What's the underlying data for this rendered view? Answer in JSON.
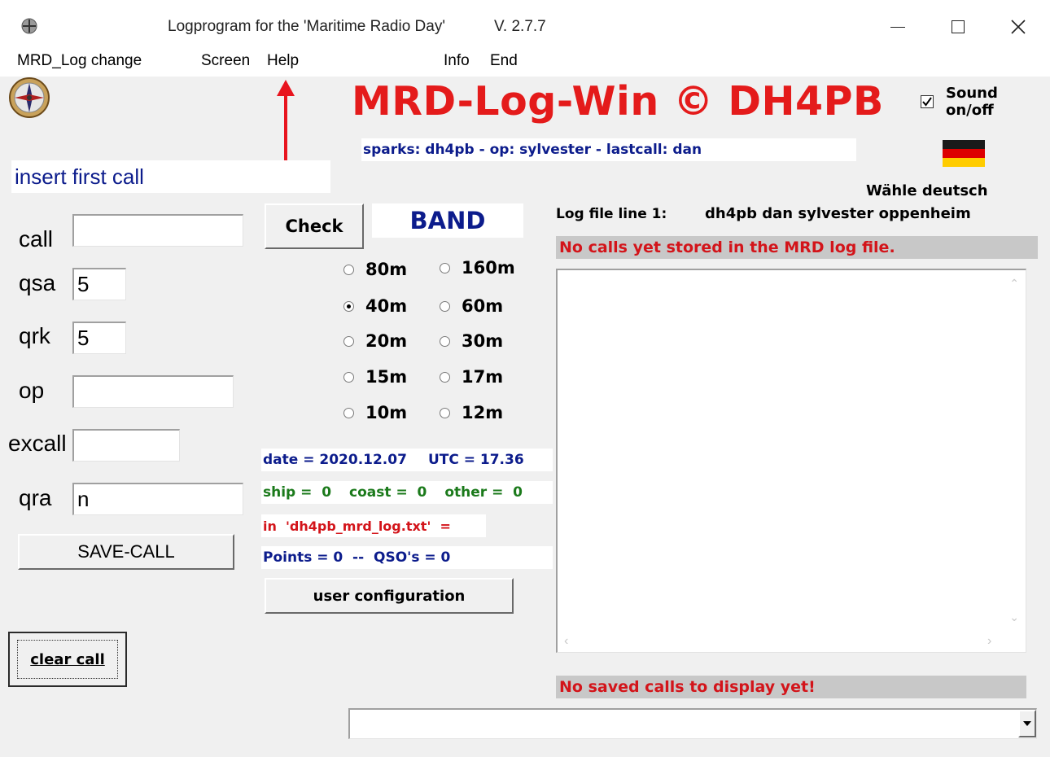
{
  "titlebar": {
    "title": "Logprogram for the 'Maritime Radio Day'",
    "version": "V. 2.7.7",
    "minimize": "—",
    "maximize": "☐",
    "close": "✕"
  },
  "menu": {
    "mrd_log_change": "MRD_Log change",
    "screen": "Screen",
    "help": "Help",
    "info": "Info",
    "end": "End"
  },
  "header": {
    "logo_title": "MRD-Log-Win © DH4PB",
    "sound_label_line1": "Sound",
    "sound_label_line2": "on/off",
    "sound_checked": true,
    "status_line": "sparks: dh4pb - op: sylvester - lastcall: dan",
    "language_label": "Wähle deutsch"
  },
  "left": {
    "prompt": "insert first call",
    "fields": {
      "call": {
        "label": "call",
        "value": ""
      },
      "qsa": {
        "label": "qsa",
        "value": "5"
      },
      "qrk": {
        "label": "qrk",
        "value": "5"
      },
      "op": {
        "label": "op",
        "value": ""
      },
      "excall": {
        "label": "excall",
        "value": ""
      },
      "qra": {
        "label": "qra",
        "value": "n"
      }
    },
    "save_button": "SAVE-CALL",
    "clear_button": "clear call"
  },
  "middle": {
    "check_button": "Check",
    "band_title": "BAND",
    "bands": [
      {
        "label": "80m",
        "selected": false
      },
      {
        "label": "160m",
        "selected": false
      },
      {
        "label": "40m",
        "selected": true
      },
      {
        "label": "60m",
        "selected": false
      },
      {
        "label": "20m",
        "selected": false
      },
      {
        "label": "30m",
        "selected": false
      },
      {
        "label": "15m",
        "selected": false
      },
      {
        "label": "17m",
        "selected": false
      },
      {
        "label": "10m",
        "selected": false
      },
      {
        "label": "12m",
        "selected": false
      }
    ],
    "date_line": "date = 2020.12.07",
    "utc_line": "UTC = 17.36",
    "ship": "ship =  0",
    "coast": "coast =  0",
    "other": "other =  0",
    "file_line": "in  'dh4pb_mrd_log.txt'  =",
    "points_line": "Points = 0  --  QSO's = 0",
    "user_config_button": "user configuration"
  },
  "right": {
    "log_file_label": "Log file line 1:",
    "log_file_value": "dh4pb dan sylvester oppenheim",
    "no_calls_message": "No calls yet stored in the MRD log file.",
    "no_saved_message": "No saved calls to display yet!",
    "combo_value": ""
  },
  "colors": {
    "logo_red": "#e41b1b",
    "navy": "#0c1c8c",
    "green": "#1b7a1b",
    "alert_red": "#d3141a",
    "annotation_arrow": "#e8141e"
  }
}
